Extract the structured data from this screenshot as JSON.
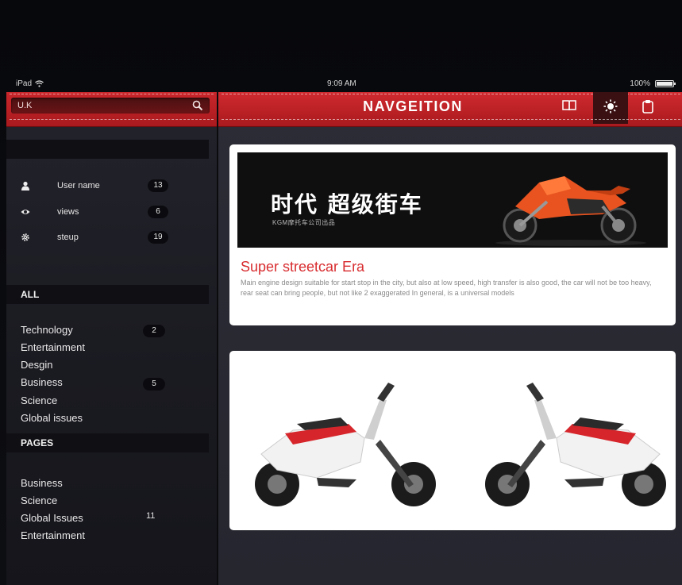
{
  "status_bar": {
    "device": "iPad",
    "time": "9:09 AM",
    "battery": "100%",
    "battery_level": 1.0
  },
  "search": {
    "value": "U.K",
    "icon": "search-icon"
  },
  "profile": {
    "stats": [
      {
        "label": "User name",
        "count": "13",
        "icon": "user-icon"
      },
      {
        "label": "views",
        "count": "6",
        "icon": "eye-icon"
      },
      {
        "label": "steup",
        "count": "19",
        "icon": "gear-icon"
      }
    ]
  },
  "sections": {
    "all_label": "ALL",
    "pages_label": "PAGES"
  },
  "all_items": [
    {
      "label": "Technology",
      "count": "2"
    },
    {
      "label": "Entertainment",
      "count": ""
    },
    {
      "label": "Desgin",
      "count": ""
    },
    {
      "label": "Business",
      "count": "5"
    },
    {
      "label": "Science",
      "count": ""
    },
    {
      "label": "Global  issues",
      "count": ""
    }
  ],
  "pages_items": [
    {
      "label": "Business",
      "count": ""
    },
    {
      "label": "Science",
      "count": ""
    },
    {
      "label": "Global  Issues",
      "count": "11"
    },
    {
      "label": "Entertainment",
      "count": ""
    }
  ],
  "header": {
    "title": "NAVGEITION",
    "actions": [
      {
        "name": "book-button",
        "icon": "book-icon",
        "active": false
      },
      {
        "name": "brightness-button",
        "icon": "sun-icon",
        "active": true
      },
      {
        "name": "clipboard-button",
        "icon": "clipboard-icon",
        "active": false
      }
    ]
  },
  "feed": {
    "card1": {
      "banner_title": "时代 超级街车",
      "banner_subtitle": "KGM摩托车公司出品",
      "title": "Super streetcar Era",
      "description": "Main engine design suitable for start stop in the city, but also at low speed, high transfer is also good, the car will not be too heavy, rear seat can bring people, but not like 2 exaggerated In general, is a universal models"
    },
    "card2": {
      "image": "scooters-image"
    }
  },
  "colors": {
    "accent_red": "#c9262b",
    "title_red": "#d82c2f",
    "sidebar_bg": "#1c1c23",
    "main_bg": "#2a2a33"
  }
}
